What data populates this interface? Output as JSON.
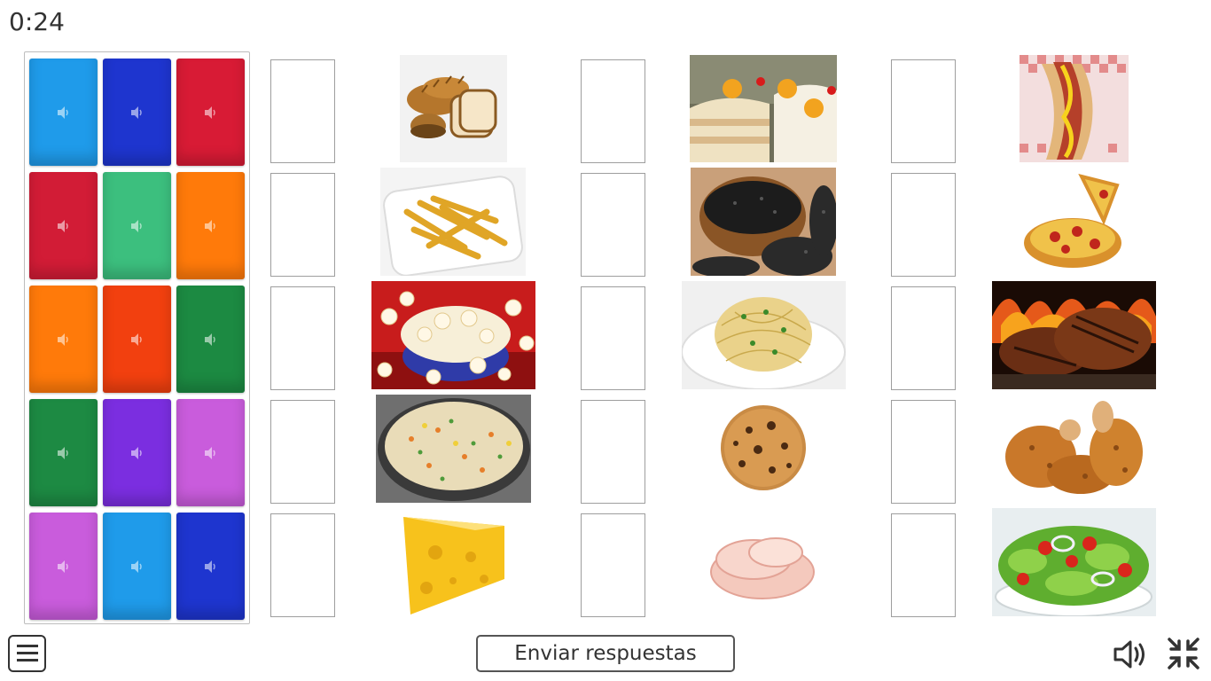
{
  "timer": "0:24",
  "submit_label": "Enviar respuestas",
  "cards": [
    {
      "color": "#1f9bea"
    },
    {
      "color": "#1e35cf"
    },
    {
      "color": "#d81b35"
    },
    {
      "color": "#d21c36"
    },
    {
      "color": "#3cbf7e"
    },
    {
      "color": "#ff7a0a"
    },
    {
      "color": "#ff7a0a"
    },
    {
      "color": "#f2400f"
    },
    {
      "color": "#1c8a42"
    },
    {
      "color": "#1d8a43"
    },
    {
      "color": "#7b2ee0"
    },
    {
      "color": "#c95cdc"
    },
    {
      "color": "#c95cdc"
    },
    {
      "color": "#1f9bea"
    },
    {
      "color": "#1e35cf"
    }
  ],
  "pictures": [
    "bread-picture",
    "cake-picture",
    "hotdog-picture",
    "fries-picture",
    "beans-picture",
    "pizza-picture",
    "popcorn-picture",
    "spaghetti-picture",
    "steak-picture",
    "rice-picture",
    "cookie-picture",
    "fried-chicken-picture",
    "cheese-picture",
    "ham-picture",
    "salad-picture"
  ],
  "icons": {
    "menu": "hamburger-menu-icon",
    "sound": "speaker-icon",
    "shrink": "exit-fullscreen-icon",
    "card": "speaker-icon"
  }
}
